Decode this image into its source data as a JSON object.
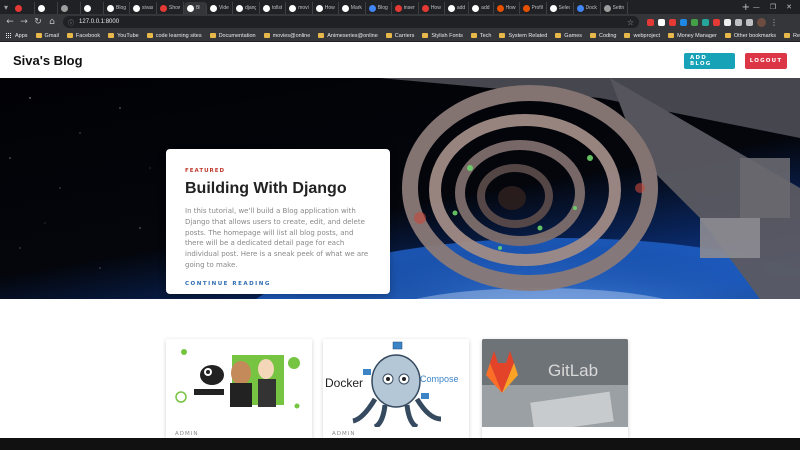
{
  "browser": {
    "tabs": [
      {
        "label": "",
        "color": "#e53935"
      },
      {
        "label": "",
        "color": "#ffffff"
      },
      {
        "label": "",
        "color": "#9e9e9e"
      },
      {
        "label": "",
        "color": "#ffffff"
      },
      {
        "label": "Blog",
        "color": "#ffffff"
      },
      {
        "label": "sivas",
        "color": "#ffffff"
      },
      {
        "label": "Show",
        "color": "#e53935"
      },
      {
        "label": "Bl",
        "color": "#ffffff",
        "active": true
      },
      {
        "label": "Vide",
        "color": "#ffffff"
      },
      {
        "label": "djang",
        "color": "#ffffff"
      },
      {
        "label": "tollst",
        "color": "#ffffff"
      },
      {
        "label": "movi",
        "color": "#ffffff"
      },
      {
        "label": "How",
        "color": "#ffffff"
      },
      {
        "label": "Mark",
        "color": "#ffffff"
      },
      {
        "label": "Blog",
        "color": "#4285f4"
      },
      {
        "label": "insert",
        "color": "#e53935"
      },
      {
        "label": "How",
        "color": "#e53935"
      },
      {
        "label": "add",
        "color": "#ffffff"
      },
      {
        "label": "add",
        "color": "#ffffff"
      },
      {
        "label": "How",
        "color": "#e65100"
      },
      {
        "label": "Profil",
        "color": "#e65100"
      },
      {
        "label": "Selec",
        "color": "#ffffff"
      },
      {
        "label": "Dock",
        "color": "#4285f4"
      },
      {
        "label": "Settn",
        "color": "#9e9e9e"
      }
    ],
    "url": "127.0.0.1:8000",
    "bookmarks": [
      "Apps",
      "Gmail",
      "Facebook",
      "YouTube",
      "code learning sites",
      "Documentation",
      "movies@online",
      "Animeseries@online",
      "Carriers",
      "Stylish Fonts",
      "Tech",
      "System Related",
      "Games",
      "Coding",
      "webproject",
      "Money Manager"
    ],
    "bookmarks_right": [
      "Other bookmarks",
      "Reading list"
    ]
  },
  "site": {
    "brand": "Siva's Blog",
    "add_blog": "ADD BLOG",
    "logout": "LOGOUT"
  },
  "featured": {
    "tag": "FEATURED",
    "title": "Building With Django",
    "excerpt": "In this tutorial, we'll build a Blog application with Django that allows users to create, edit, and delete posts. The homepage will list all blog posts, and there will be a dedicated detail page for each individual post. Here is a sneak peek of what we are going to make.",
    "cta": "CONTINUE READING"
  },
  "posts": [
    {
      "author": "ADMIN"
    },
    {
      "author": "ADMIN",
      "thumb_text": "Docker",
      "thumb_sub": "Compose"
    },
    {
      "author": "",
      "thumb_text": "GitLab"
    }
  ],
  "colors": {
    "accent_add": "#17a2b8",
    "accent_logout": "#dc3545",
    "featured_tag": "#c0392b",
    "link": "#2d6bb0"
  }
}
